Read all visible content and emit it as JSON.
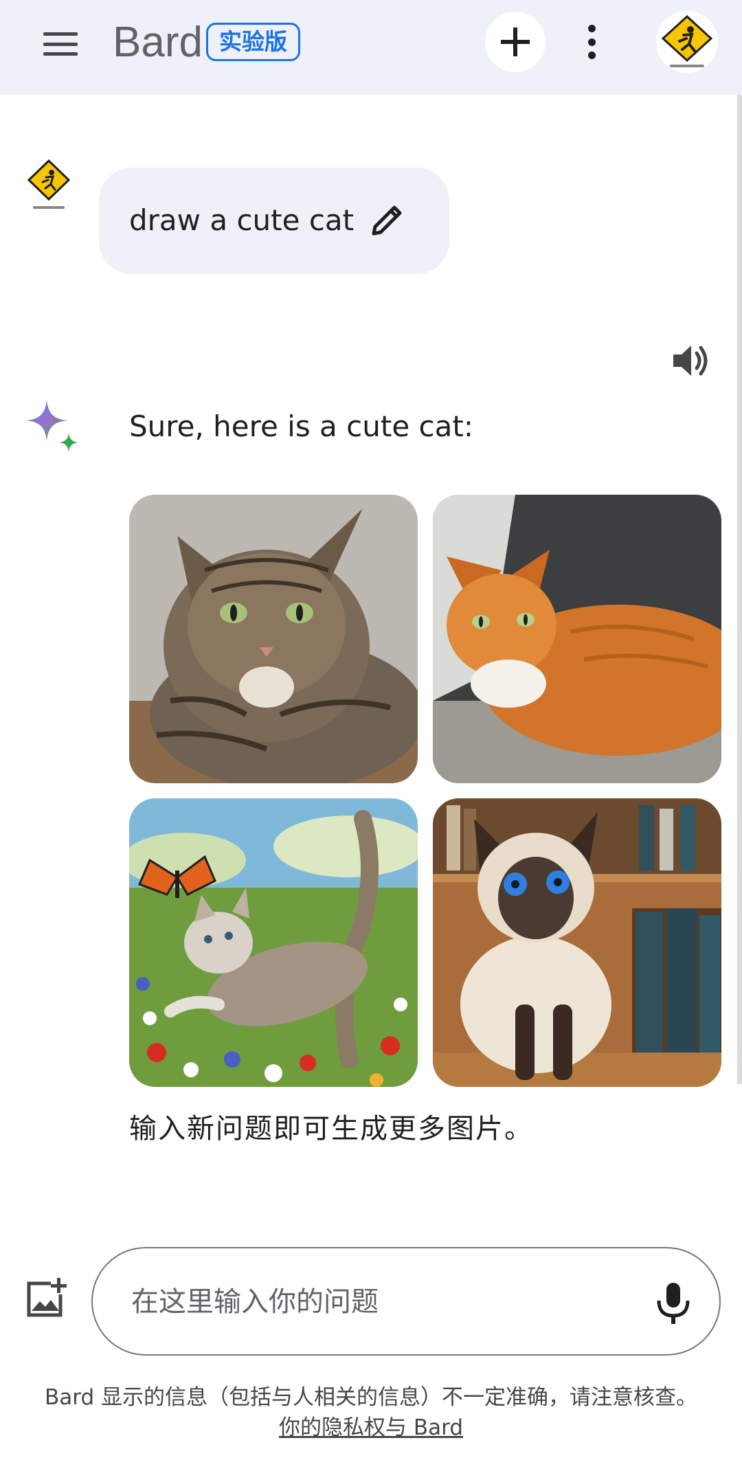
{
  "header": {
    "brand": "Bard",
    "badge": "实验版"
  },
  "conversation": {
    "user_prompt": "draw a cute cat",
    "response_text": "Sure, here is a cute cat:",
    "images": [
      {
        "subject": "tabby-cat"
      },
      {
        "subject": "orange-cat"
      },
      {
        "subject": "painted-kitten-with-butterfly"
      },
      {
        "subject": "siamese-cat-with-books"
      }
    ],
    "followup_text": "输入新问题即可生成更多图片。"
  },
  "input": {
    "placeholder": "在这里输入你的问题",
    "value": ""
  },
  "footer": {
    "disclaimer": "Bard 显示的信息（包括与人相关的信息）不一定准确，请注意核查。",
    "privacy_link": "你的隐私权与 Bard"
  },
  "icons": {
    "menu": "hamburger-menu-icon",
    "new_chat": "plus-icon",
    "more": "more-vert-icon",
    "edit": "pencil-icon",
    "speaker": "volume-up-icon",
    "bard": "sparkle-icon",
    "add_image": "add-photo-icon",
    "mic": "mic-icon"
  },
  "colors": {
    "header_bg": "#eef1f8",
    "accent": "#1a73e8",
    "bubble_bg": "#eef1f8",
    "avatar_sign": "#f7c600"
  }
}
